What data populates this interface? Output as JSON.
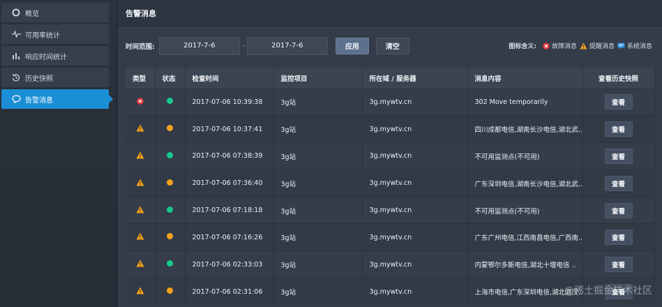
{
  "sidebar": {
    "items": [
      {
        "label": "概览",
        "icon": "overview-icon"
      },
      {
        "label": "可用率统计",
        "icon": "pulse-icon"
      },
      {
        "label": "响应时间统计",
        "icon": "bar-chart-icon"
      },
      {
        "label": "历史快照",
        "icon": "history-icon"
      },
      {
        "label": "告警消息",
        "icon": "alert-message-icon",
        "active": true
      }
    ]
  },
  "header": {
    "title": "告警消息"
  },
  "filter": {
    "label": "时间范围:",
    "start_date": "2017-7-6",
    "separator": "–",
    "end_date": "2017-7-6",
    "apply_label": "应用",
    "clear_label": "清空"
  },
  "legend": {
    "title": "图标含义:",
    "items": [
      {
        "label": "故障消息",
        "icon": "fault-icon"
      },
      {
        "label": "提醒消息",
        "icon": "warning-icon"
      },
      {
        "label": "系统消息",
        "icon": "system-message-icon"
      }
    ]
  },
  "table": {
    "headers": [
      "类型",
      "状态",
      "检查时间",
      "监控项目",
      "所在域 / 服务器",
      "消息内容",
      "查看历史快照"
    ],
    "view_label": "查看",
    "rows": [
      {
        "type": "fault",
        "status": "green",
        "time": "2017-07-06 10:39:38",
        "project": "3g站",
        "server": "3g.mywtv.cn",
        "message": "302 Move temporarily"
      },
      {
        "type": "warning",
        "status": "orange",
        "time": "2017-07-06 10:37:41",
        "project": "3g站",
        "server": "3g.mywtv.cn",
        "message": "四川成都电信,湖南长沙电信,湖北武.."
      },
      {
        "type": "warning",
        "status": "green",
        "time": "2017-07-06 07:38:39",
        "project": "3g站",
        "server": "3g.mywtv.cn",
        "message": "不可用监测点(不可用)"
      },
      {
        "type": "warning",
        "status": "orange",
        "time": "2017-07-06 07:36:40",
        "project": "3g站",
        "server": "3g.mywtv.cn",
        "message": "广东深圳电信,湖南长沙电信,湖北武.."
      },
      {
        "type": "warning",
        "status": "green",
        "time": "2017-07-06 07:18:18",
        "project": "3g站",
        "server": "3g.mywtv.cn",
        "message": "不可用监测点(不可用)"
      },
      {
        "type": "warning",
        "status": "orange",
        "time": "2017-07-06 07:16:26",
        "project": "3g站",
        "server": "3g.mywtv.cn",
        "message": "广东广州电信,江西南昌电信,广西南.."
      },
      {
        "type": "warning",
        "status": "green",
        "time": "2017-07-06 02:33:03",
        "project": "3g站",
        "server": "3g.mywtv.cn",
        "message": "内蒙鄂尔多斯电信,湖北十堰电信 .."
      },
      {
        "type": "warning",
        "status": "orange",
        "time": "2017-07-06 02:31:06",
        "project": "3g站",
        "server": "3g.mywtv.cn",
        "message": "上海市电信,广东深圳电信,湖北武汉.."
      }
    ]
  },
  "watermark": "@稀土掘金技术社区",
  "colors": {
    "accent": "#1b8fd6",
    "fault": "#e0393e",
    "warning": "#f5a31c",
    "ok": "#16c98a",
    "system": "#2f8fe0"
  }
}
